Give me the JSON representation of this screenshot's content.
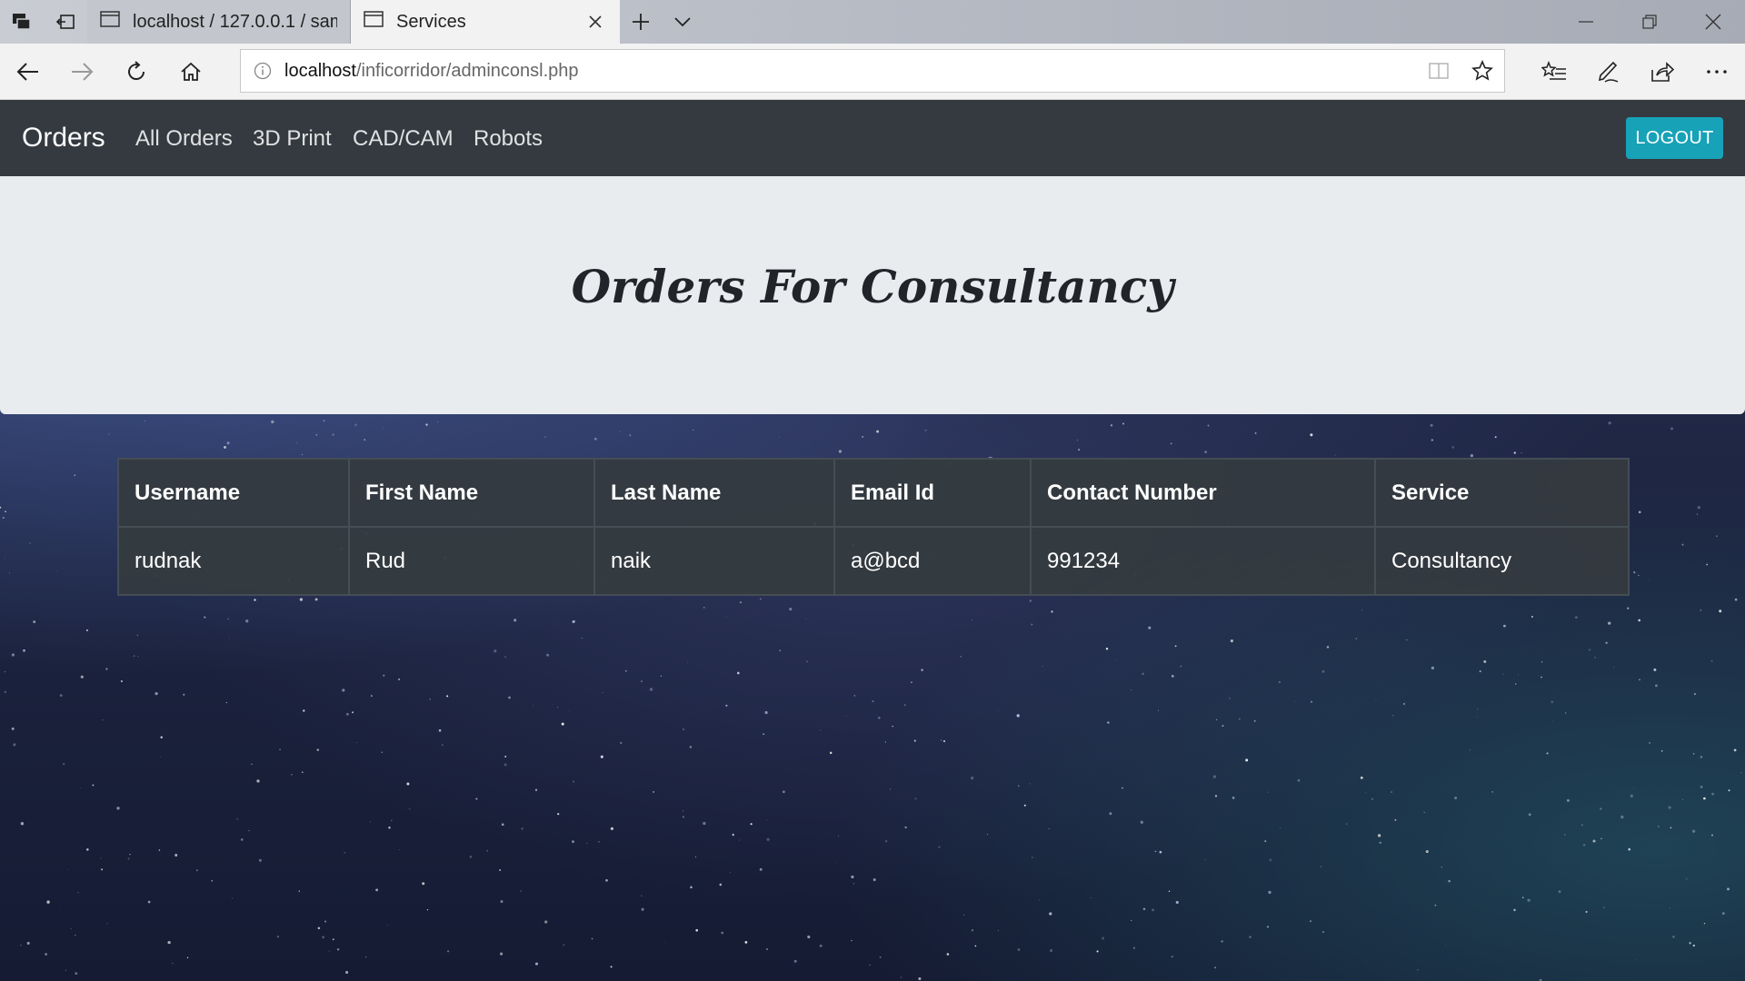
{
  "browser": {
    "tabs": [
      {
        "title": "localhost / 127.0.0.1 / samp",
        "active": false
      },
      {
        "title": "Services",
        "active": true
      }
    ],
    "address": {
      "host": "localhost",
      "path": "/inficorridor/adminconsl.php"
    },
    "icons": [
      "tab-preview-icon",
      "set-aside-tabs-icon",
      "page-icon",
      "close-icon",
      "new-tab-icon",
      "tab-list-chevron-icon",
      "minimize-icon",
      "restore-icon",
      "close-window-icon",
      "back-icon",
      "forward-icon",
      "refresh-icon",
      "home-icon",
      "info-icon",
      "reading-view-icon",
      "favorite-star-icon",
      "favorites-list-icon",
      "pen-icon",
      "share-icon",
      "more-icon"
    ]
  },
  "app": {
    "brand": "Orders",
    "nav_links": [
      "All Orders",
      "3D Print",
      "CAD/CAM",
      "Robots"
    ],
    "logout_label": "LOGOUT",
    "accent_color": "#17a2b8",
    "navbar_color": "#343a40"
  },
  "jumbotron": {
    "title": "Orders For Consultancy"
  },
  "table": {
    "headers": [
      "Username",
      "First Name",
      "Last Name",
      "Email Id",
      "Contact Number",
      "Service"
    ],
    "rows": [
      [
        "rudnak",
        "Rud",
        "naik",
        "a@bcd",
        "991234",
        "Consultancy"
      ]
    ]
  }
}
